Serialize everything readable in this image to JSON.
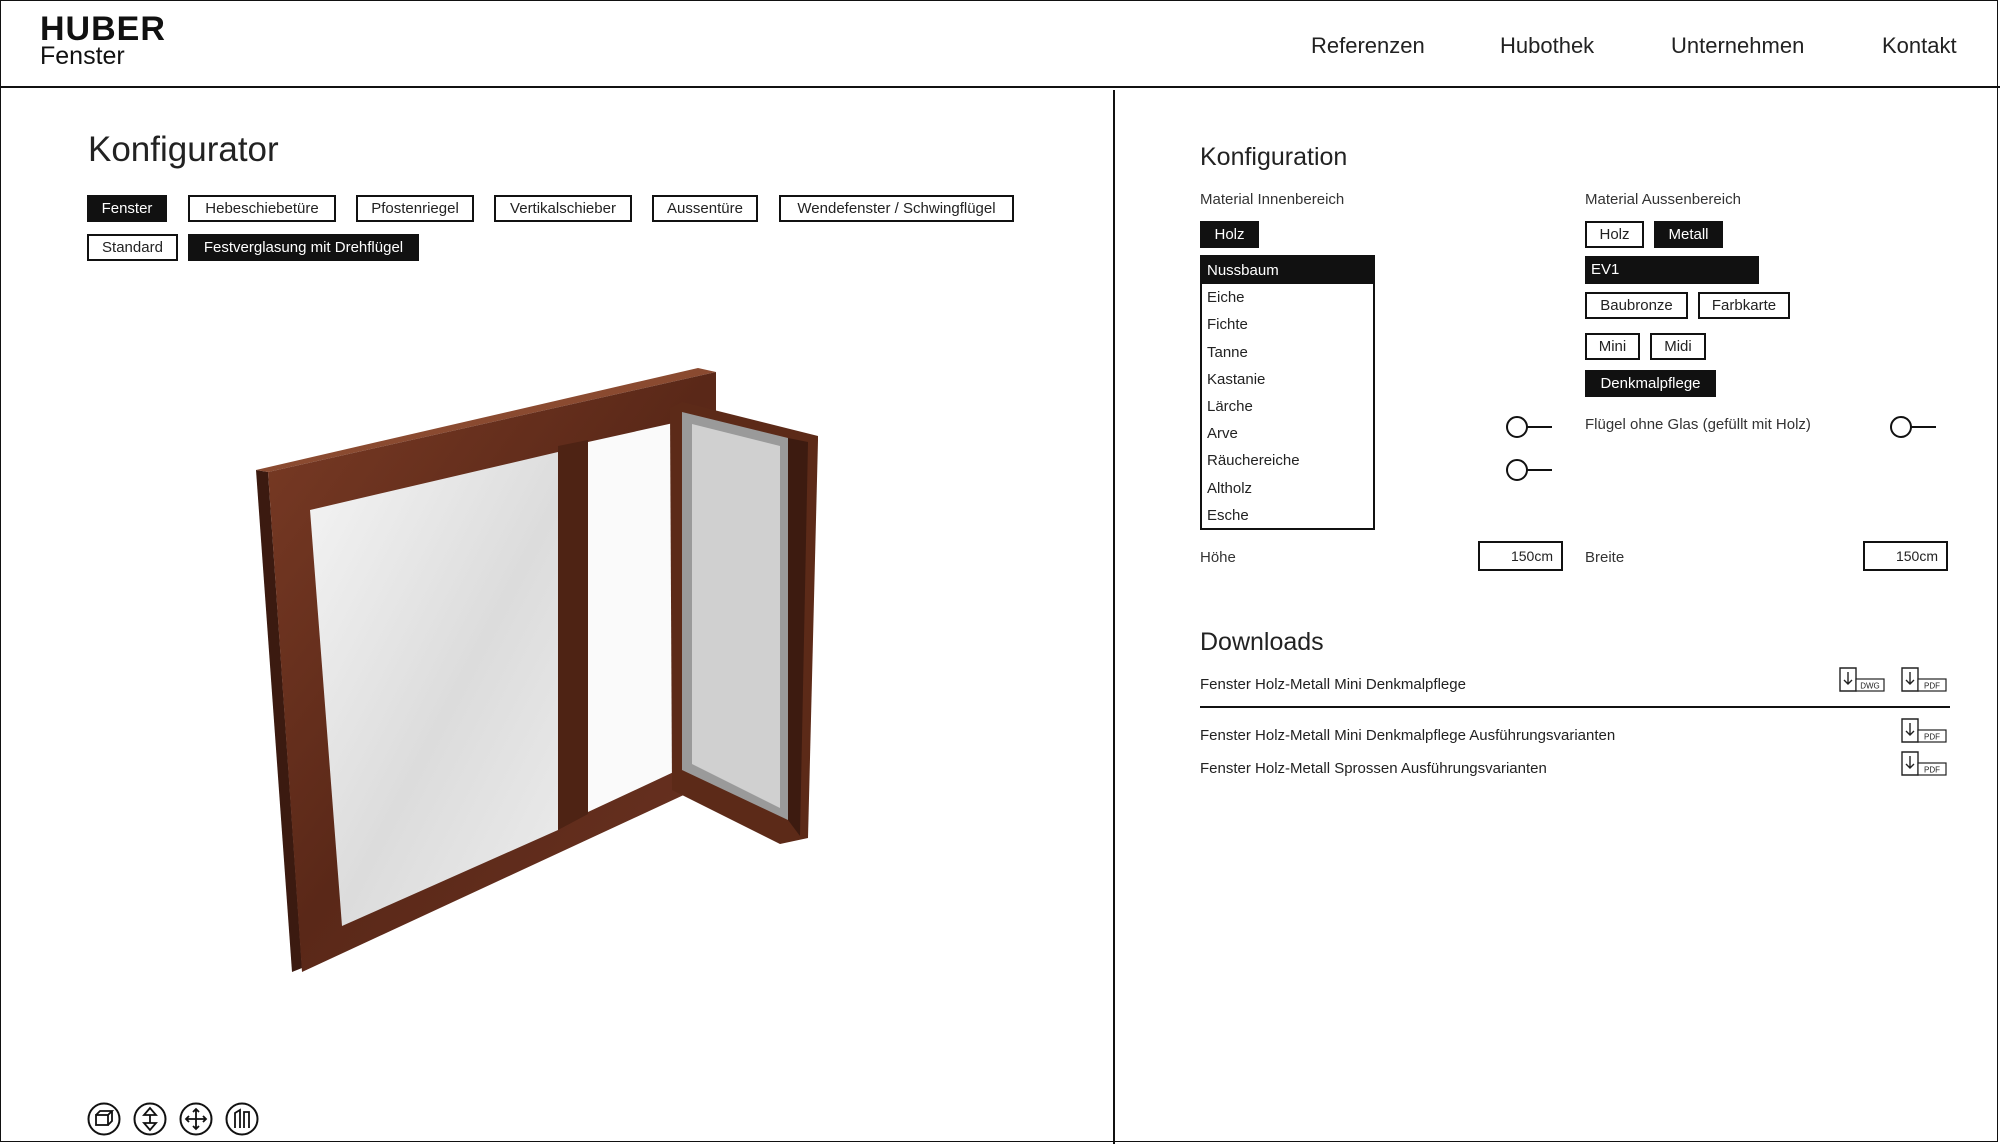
{
  "brand": {
    "line1": "HUBER",
    "line2": "Fenster"
  },
  "nav": [
    "Referenzen",
    "Hubothek",
    "Unternehmen",
    "Kontakt"
  ],
  "left": {
    "title": "Konfigurator",
    "types": [
      {
        "label": "Fenster",
        "active": true
      },
      {
        "label": "Hebeschiebetüre",
        "active": false
      },
      {
        "label": "Pfostenriegel",
        "active": false
      },
      {
        "label": "Vertikalschieber",
        "active": false
      },
      {
        "label": "Aussentüre",
        "active": false
      },
      {
        "label": "Wendefenster / Schwingflügel",
        "active": false
      }
    ],
    "variants": [
      {
        "label": "Standard",
        "active": false
      },
      {
        "label": "Festverglasung mit Drehflügel",
        "active": true
      }
    ],
    "view_controls": [
      "box-view-icon",
      "vertical-move-icon",
      "pan-move-icon",
      "section-view-icon"
    ]
  },
  "config": {
    "title": "Konfiguration",
    "inner": {
      "label": "Material Innenbereich",
      "materials": [
        {
          "label": "Holz",
          "active": true
        }
      ],
      "woods": [
        "Nussbaum",
        "Eiche",
        "Fichte",
        "Tanne",
        "Kastanie",
        "Lärche",
        "Arve",
        "Räuchereiche",
        "Altholz",
        "Esche"
      ],
      "selected_wood": "Nussbaum",
      "hoehe_label": "Höhe",
      "hoehe_value": "150cm"
    },
    "outer": {
      "label": "Material Aussenbereich",
      "materials": [
        {
          "label": "Holz",
          "active": false
        },
        {
          "label": "Metall",
          "active": true
        }
      ],
      "color_selected": "EV1",
      "colors": [
        {
          "label": "Baubronze",
          "active": false
        },
        {
          "label": "Farbkarte",
          "active": false
        }
      ],
      "profiles": [
        {
          "label": "Mini",
          "active": false
        },
        {
          "label": "Midi",
          "active": false
        }
      ],
      "style": {
        "label": "Denkmalpflege",
        "active": true
      },
      "glass_toggle_label": "Flügel ohne Glas (gefüllt mit Holz)",
      "breite_label": "Breite",
      "breite_value": "150cm"
    }
  },
  "downloads": {
    "title": "Downloads",
    "items": [
      {
        "label": "Fenster Holz-Metall Mini Denkmalpflege",
        "files": [
          "DWG",
          "PDF"
        ]
      },
      {
        "label": "Fenster Holz-Metall Mini Denkmalpflege Ausführungsvarianten",
        "files": [
          "PDF"
        ]
      },
      {
        "label": "Fenster Holz-Metall Sprossen Ausführungsvarianten",
        "files": [
          "PDF"
        ]
      }
    ]
  },
  "colors": {
    "ink": "#111111",
    "wood_dark": "#4a2114",
    "wood_mid": "#6b3322",
    "wood_light": "#8a4a30"
  }
}
